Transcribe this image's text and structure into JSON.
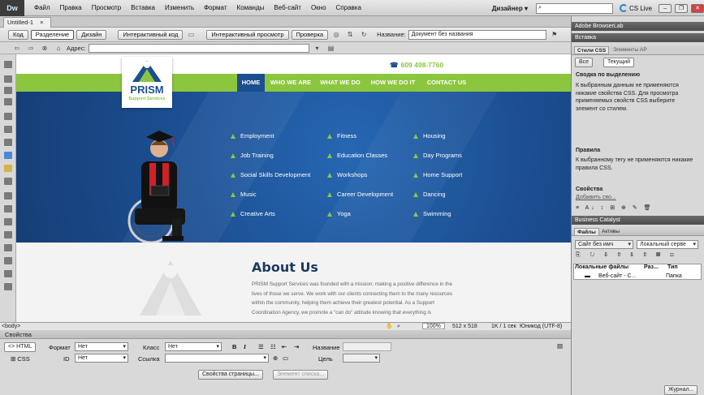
{
  "app": {
    "logo": "Dw",
    "workspace": "Дизайнер ▾",
    "cslive": "CS Live"
  },
  "menu": [
    "Файл",
    "Правка",
    "Просмотр",
    "Вставка",
    "Изменить",
    "Формат",
    "Команды",
    "Веб-сайт",
    "Окно",
    "Справка"
  ],
  "document": {
    "tab": "Untitled-1",
    "title_label": "Название:",
    "title_value": "Документ без названия",
    "address_label": "Адрес:"
  },
  "toolbar": {
    "code": "Код",
    "split": "Разделение",
    "design": "Дизайн",
    "live_code": "Интерактивный код",
    "live_view": "Интерактивный просмотр",
    "inspect": "Проверка"
  },
  "site": {
    "phone": "609 498-7760",
    "logo_name": "PRISM",
    "logo_sub": "Support Services",
    "nav": [
      "HOME",
      "WHO WE ARE",
      "WHAT WE DO",
      "HOW WE DO IT",
      "CONTACT US"
    ],
    "services": [
      [
        "Employment",
        "Fitness",
        "Housing"
      ],
      [
        "Job Training",
        "Education Classes",
        "Day Programs"
      ],
      [
        "Social Skills Development",
        "Workshops",
        "Home Support"
      ],
      [
        "Music",
        "Career Development",
        "Dancing"
      ],
      [
        "Creative Arts",
        "Yoga",
        "Swimming"
      ]
    ],
    "about_title": "About Us",
    "about_text": "PRISM Support Services was founded with a mission; making a positive difference in the lives of those we serve. We work with our clients connecting them to the many resources within the community, helping them achieve their greatest potential. As a Support Coordination Agency, we promote a \"can do\" attitude knowing that everything is"
  },
  "statusbar": {
    "tag": "<body>",
    "zoom": "100%",
    "size": "512 x 518",
    "info": "1K / 1 сек",
    "encoding": "Юникод (UTF-8)"
  },
  "properties": {
    "header": "Свойства",
    "html": "HTML",
    "css": "CSS",
    "format_label": "Формат",
    "format_value": "Нет",
    "id_label": "ID",
    "id_value": "Нет",
    "class_label": "Класс",
    "class_value": "Нет",
    "link_label": "Ссылка",
    "name_label": "Название",
    "target_label": "Цель",
    "page_props": "Свойства страницы...",
    "list_item": "Элемент списка..."
  },
  "panels": {
    "browserlab": "Adobe BrowserLab",
    "insert": "Вставка",
    "css_styles": "Стили CSS",
    "ap_elements": "Элементы AP",
    "all": "Все",
    "current": "Текущий",
    "summary_header": "Сводка по выделению",
    "summary_text": "К выбранным данным не применяются никакие свойства CSS. Для просмотра применяемых свойств CSS выберите элемент со стилем.",
    "rules_header": "Правила",
    "rules_text": "К выбранному тегу не применяются никакие правила CSS.",
    "props_header": "Свойства",
    "add_prop": "Добавить сво...",
    "business_catalyst": "Business Catalyst",
    "files": "Файлы",
    "assets": "Активы",
    "site_select": "Сайт без имч",
    "view_select": "Локальный серве",
    "col_local": "Локальные файлы",
    "col_size": "Раз...",
    "col_type": "Тип",
    "row_name": "Веб-сайт - С...",
    "row_type": "Папка",
    "log": "Журнал..."
  }
}
